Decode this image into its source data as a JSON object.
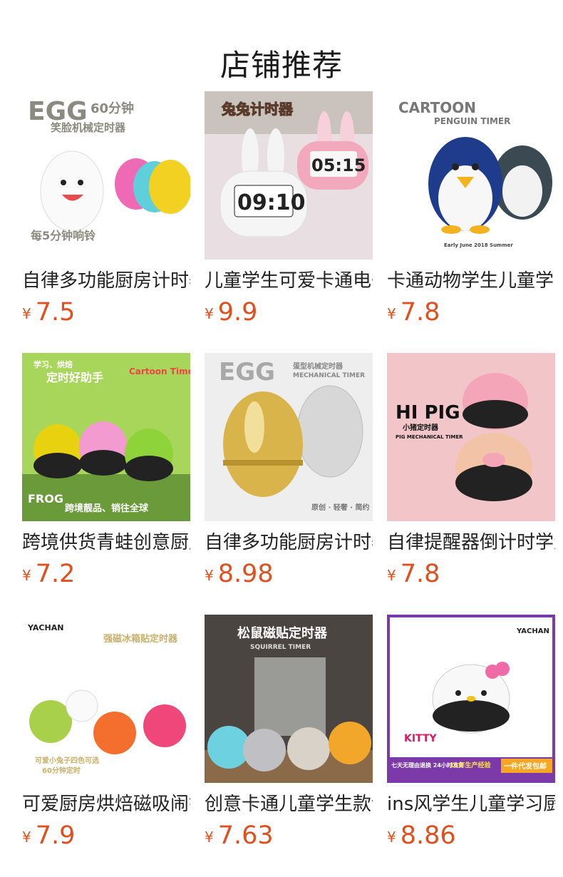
{
  "page_title": "店铺推荐",
  "currency_symbol": "¥",
  "products": [
    {
      "name": "自律多功能厨房计时器",
      "price": "7.5",
      "image": {
        "icon": "egg-timer-smiley-icon",
        "line1": "EGG",
        "line2": "60分钟",
        "line3": "笑脸机械定时器",
        "line4": "每5分钟响铃",
        "bg": "#ffffff",
        "accent": "#f1c21b"
      }
    },
    {
      "name": "儿童学生可爱卡通电子计时器",
      "price": "9.9",
      "image": {
        "icon": "bunny-timer-icon",
        "line1": "兔兔计时器",
        "line2": "09:10",
        "line3": "05:15",
        "bg": "#e9dfe2",
        "accent": "#f3a9bd"
      }
    },
    {
      "name": "卡通动物学生儿童学习计时器",
      "price": "7.8",
      "image": {
        "icon": "penguin-timer-icon",
        "line1": "CARTOON",
        "line2": "PENGUIN TIMER",
        "line3": "Early June 2018 Summer",
        "bg": "#ffffff",
        "accent": "#1f3b8c"
      }
    },
    {
      "name": "跨境供货青蛙创意厨房计时器",
      "price": "7.2",
      "image": {
        "icon": "frog-timer-icon",
        "line1": "学习、烘焙",
        "line2": "定时好助手",
        "line3": "Cartoon Timer",
        "line4": "FROG",
        "line5": "跨境靓品、销往全球",
        "bg": "#a8d65a",
        "accent": "#e8d20f"
      }
    },
    {
      "name": "自律多功能厨房计时器",
      "price": "8.98",
      "image": {
        "icon": "metal-egg-timer-icon",
        "line1": "EGG",
        "line2": "蛋型机械定时器",
        "line3": "MECHANICAL TIMER",
        "line4": "原创 · 轻奢 · 简约",
        "bg": "#eeeeee",
        "accent": "#d9b44a"
      }
    },
    {
      "name": "自律提醒器倒计时学生计时器",
      "price": "7.8",
      "image": {
        "icon": "pig-timer-icon",
        "line1": "HI PIG",
        "line2": "小猪定时器",
        "line3": "PIG MECHANICAL TIMER",
        "bg": "#f2c6c8",
        "accent": "#f4a6b8"
      }
    },
    {
      "name": "可爱厨房烘焙磁吸闹钟计时器",
      "price": "7.9",
      "image": {
        "icon": "bunny-magnet-timer-icon",
        "line1": "YACHAN",
        "line2": "强磁冰箱贴定时器",
        "line3": "可爱小兔子四色可选",
        "line4": "60分钟定时",
        "bg": "#ffffff",
        "accent": "#f46f2d"
      }
    },
    {
      "name": "创意卡通儿童学生款计时器",
      "price": "7.63",
      "image": {
        "icon": "squirrel-timer-icon",
        "line1": "松鼠磁贴定时器",
        "line2": "SQUIRREL TIMER",
        "bg": "#4a4540",
        "accent": "#d88c2c"
      }
    },
    {
      "name": "ins风学生儿童学习厨房计时器",
      "price": "8.86",
      "image": {
        "icon": "kitty-timer-icon",
        "line1": "YACHAN",
        "line2": "KITTY",
        "line3": "七天无理由退换 24小时发货",
        "line4": "13年生产经验",
        "line5": "一件代发包邮",
        "bg": "#ffffff",
        "accent": "#7c3aa8"
      }
    }
  ]
}
